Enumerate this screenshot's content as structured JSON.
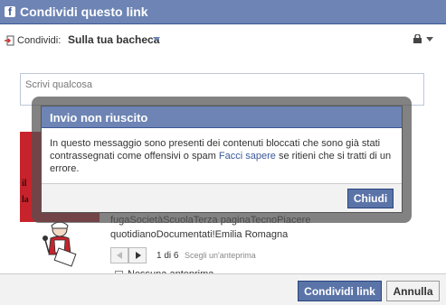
{
  "window": {
    "title": "Condividi questo link",
    "logo_letter": "f"
  },
  "share": {
    "label": "Condividi:",
    "target": "Sulla tua bacheca"
  },
  "composer": {
    "placeholder": "Scrivi qualcosa"
  },
  "preview": {
    "thumb_line1": "il",
    "thumb_line2": "la",
    "title": "fugaSocietàScuolaTerza paginaTecnoPiacere quotidianoDocumentati!Emilia Romagna",
    "pager_count": "1 di 6",
    "pager_hint": "Scegli un'anteprima",
    "no_preview_label": "Nessuna anteprima"
  },
  "footer": {
    "share_button": "Condividi link",
    "cancel_button": "Annulla"
  },
  "dialog": {
    "title": "Invio non riuscito",
    "message_before": "In questo messaggio sono presenti dei contenuti bloccati che sono già stati contrassegnati come offensivi o spam ",
    "link_text": "Facci sapere",
    "message_after": " se ritieni che si tratti di un errore.",
    "close_button": "Chiudi"
  },
  "colors": {
    "brand_blue": "#6d84b4",
    "button_blue": "#5b74a8",
    "link_blue": "#3b5998"
  }
}
